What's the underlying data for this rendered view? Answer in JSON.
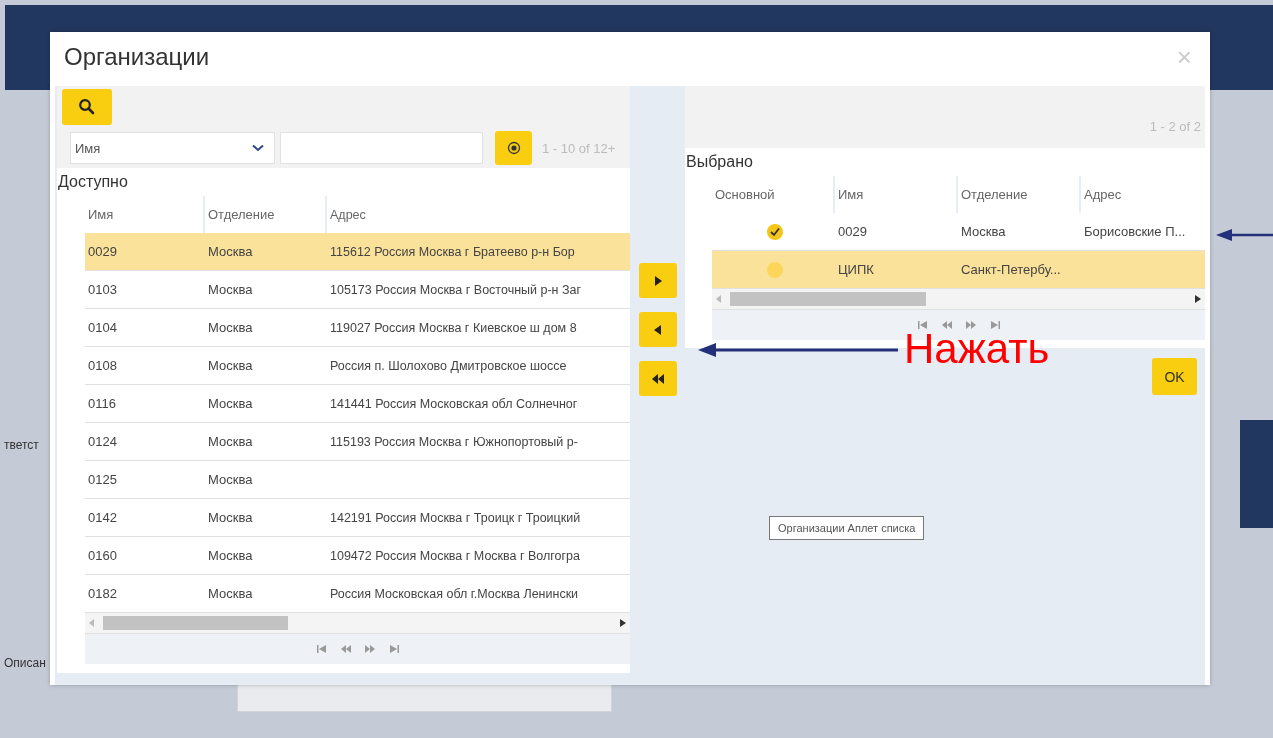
{
  "page": {
    "background_labels": [
      "тветст",
      "Описан"
    ]
  },
  "dialog": {
    "title": "Организации",
    "close": "×"
  },
  "available": {
    "filter_field": "Имя",
    "pager_text": "1 - 10 of 12+",
    "heading": "Доступно",
    "columns": [
      "Имя",
      "Отделение",
      "Адрес"
    ],
    "rows": [
      {
        "name": "0029",
        "branch": "Москва",
        "address": "115612 Россия Москва г Братеево р-н Бор",
        "selected": true
      },
      {
        "name": "0103",
        "branch": "Москва",
        "address": "105173 Россия Москва г Восточный р-н Заг",
        "selected": false
      },
      {
        "name": "0104",
        "branch": "Москва",
        "address": "119027 Россия Москва г Киевское ш дом 8",
        "selected": false
      },
      {
        "name": "0108",
        "branch": "Москва",
        "address": "Россия п. Шолохово Дмитровское шоссе",
        "selected": false
      },
      {
        "name": "0116",
        "branch": "Москва",
        "address": "141441 Россия Московская обл Солнечног",
        "selected": false
      },
      {
        "name": "0124",
        "branch": "Москва",
        "address": "115193 Россия Москва г Южнопортовый р-",
        "selected": false
      },
      {
        "name": "0125",
        "branch": "Москва",
        "selected": false
      },
      {
        "name": "0142",
        "branch": "Москва",
        "address": "142191 Россия Москва г Троицк г Троицкий",
        "selected": false
      },
      {
        "name": "0160",
        "branch": "Москва",
        "address": "109472 Россия Москва г Москва г Волгогра",
        "selected": false
      },
      {
        "name": "0182",
        "branch": "Москва",
        "address": "Россия Московская обл г.Москва Ленински",
        "selected": false
      }
    ]
  },
  "transfer_buttons": [
    {
      "kind": "add"
    },
    {
      "kind": "remove"
    },
    {
      "kind": "remove_all"
    }
  ],
  "chosen": {
    "pager_text": "1 - 2 of 2",
    "heading": "Выбрано",
    "columns": [
      "Основной",
      "Имя",
      "Отделение",
      "Адрес"
    ],
    "rows": [
      {
        "primary": true,
        "name": "0029",
        "branch": "Москва",
        "address": "Борисовские П...",
        "selected": false
      },
      {
        "primary": false,
        "name": "ЦИПК",
        "branch": "Санкт-Петербу...",
        "selected": true
      }
    ]
  },
  "ok_button": "OK",
  "tooltip": "Организации Аплет списка",
  "annotation": {
    "text": "Нажать"
  }
}
